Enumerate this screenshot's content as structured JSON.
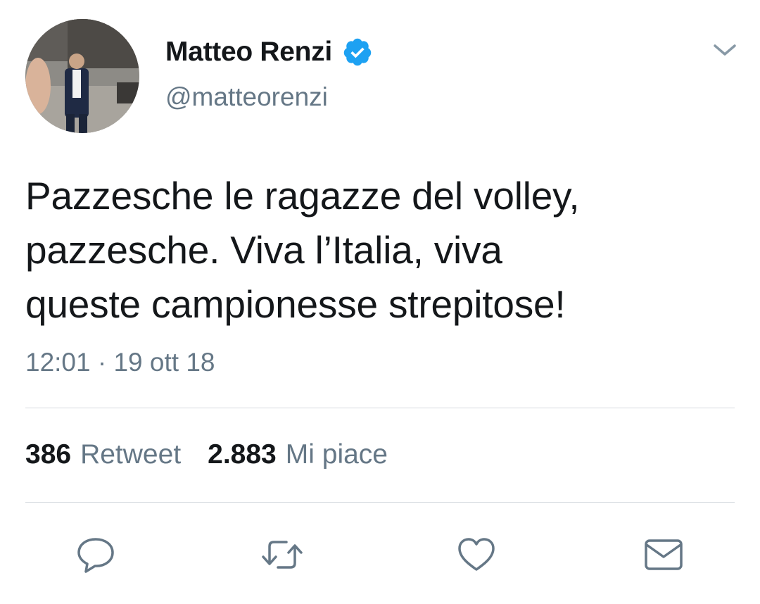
{
  "tweet": {
    "display_name": "Matteo Renzi",
    "verified_icon": "verified-badge-icon",
    "handle": "@matteorenzi",
    "text_lines": [
      "Pazzesche le ragazze del volley,",
      "pazzesche. Viva l’Italia, viva",
      "queste campionesse strepitose!"
    ],
    "timestamp": "12:01 · 19 ott 18",
    "stats": {
      "retweets_count": "386",
      "retweets_label": "Retweet",
      "likes_count": "2.883",
      "likes_label": "Mi piace"
    }
  },
  "actions": [
    {
      "name": "reply",
      "icon": "comment-bubble-icon"
    },
    {
      "name": "retweet",
      "icon": "retweet-arrows-icon"
    },
    {
      "name": "like",
      "icon": "heart-icon"
    },
    {
      "name": "direct-message",
      "icon": "envelope-icon"
    }
  ],
  "colors": {
    "text_primary": "#14171a",
    "text_secondary": "#657786",
    "verified_blue": "#1da1f2",
    "divider": "#d6dbe0"
  }
}
